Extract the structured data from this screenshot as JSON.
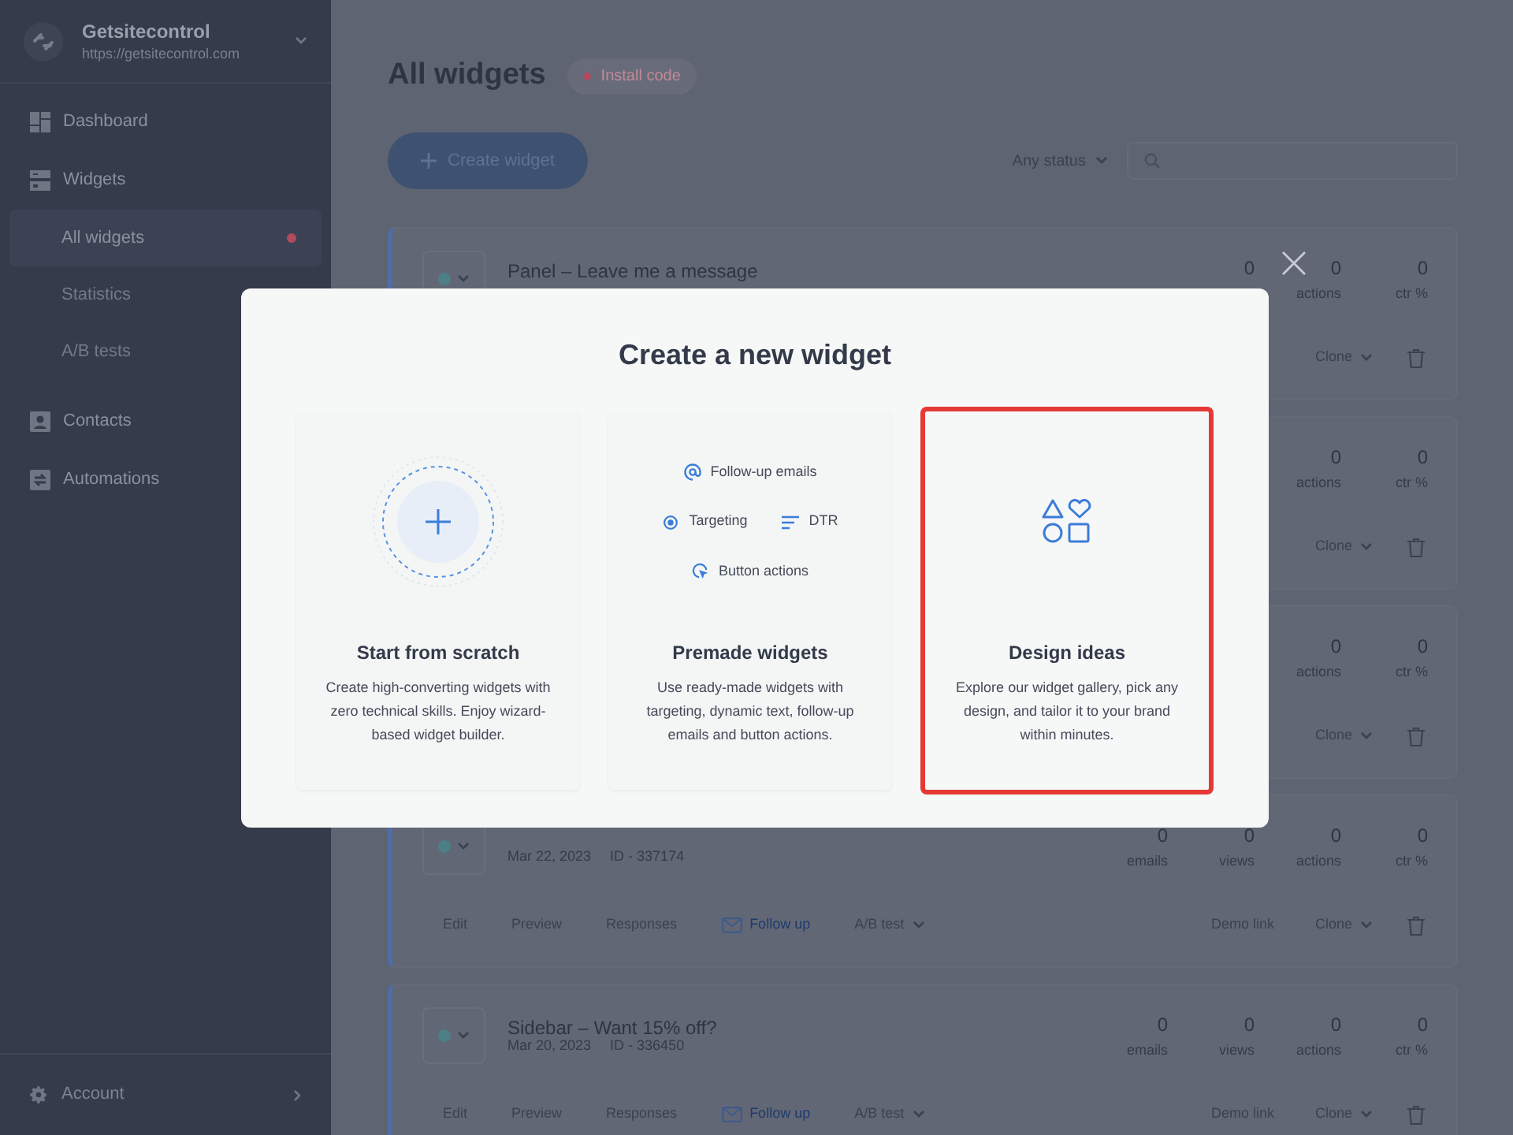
{
  "sidebar": {
    "brand": {
      "name": "Getsitecontrol",
      "url": "https://getsitecontrol.com"
    },
    "items": [
      {
        "kind": "section",
        "label": "Dashboard",
        "selected": false
      },
      {
        "kind": "section",
        "label": "Widgets",
        "selected": false
      },
      {
        "kind": "sub",
        "label": "All widgets",
        "selected": true,
        "alert": true
      },
      {
        "kind": "sub",
        "label": "Statistics",
        "selected": false
      },
      {
        "kind": "sub",
        "label": "A/B tests",
        "selected": false
      },
      {
        "kind": "section",
        "label": "Contacts",
        "selected": false
      },
      {
        "kind": "section",
        "label": "Automations",
        "selected": false
      }
    ],
    "account": "Account"
  },
  "header": {
    "title": "All widgets",
    "badge": "Install code",
    "create_button": "Create widget",
    "status_filter": "Any status"
  },
  "widgets": [
    {
      "title": "Panel – Leave me a message",
      "status_menu": true,
      "stats": [
        {
          "value": "0"
        },
        {
          "value": "0",
          "label": "actions"
        },
        {
          "value": "0",
          "label": "ctr %"
        }
      ],
      "right_actions": [
        "Clone"
      ]
    },
    {
      "stats": [
        {
          "value": "0",
          "label": "actions"
        },
        {
          "value": "0",
          "label": "ctr %"
        }
      ],
      "right_actions": [
        "Clone"
      ]
    },
    {
      "stats": [
        {
          "value": "0",
          "label": "actions"
        },
        {
          "value": "0",
          "label": "ctr %"
        }
      ],
      "right_actions": [
        "Clone"
      ]
    },
    {
      "status_menu": true,
      "date": "Mar 22, 2023",
      "id": "ID - 337174",
      "stats": [
        {
          "value": "0",
          "label": "emails"
        },
        {
          "value": "0",
          "label": "views"
        },
        {
          "value": "0",
          "label": "actions"
        },
        {
          "value": "0",
          "label": "ctr %"
        }
      ],
      "left_actions": [
        "Edit",
        "Preview",
        "Responses",
        "Follow up",
        "A/B test"
      ],
      "right_actions": [
        "Demo link",
        "Clone"
      ]
    },
    {
      "title": "Sidebar – Want 15% off?",
      "status_menu": true,
      "date": "Mar 20, 2023",
      "id": "ID - 336450",
      "stats": [
        {
          "value": "0",
          "label": "emails"
        },
        {
          "value": "0",
          "label": "views"
        },
        {
          "value": "0",
          "label": "actions"
        },
        {
          "value": "0",
          "label": "ctr %"
        }
      ],
      "left_actions": [
        "Edit",
        "Preview",
        "Responses",
        "Follow up",
        "A/B test"
      ],
      "right_actions": [
        "Demo link",
        "Clone"
      ]
    }
  ],
  "modal": {
    "title": "Create a new widget",
    "options": [
      {
        "kind": "scratch",
        "title": "Start from scratch",
        "description": "Create high-converting widgets with zero technical skills. Enjoy wizard-based widget builder.",
        "highlighted": false
      },
      {
        "kind": "premade",
        "title": "Premade widgets",
        "description": "Use ready-made widgets with targeting, dynamic text, follow-up emails and button actions.",
        "highlighted": false,
        "feature_rows": [
          [
            "Follow-up emails"
          ],
          [
            "Targeting",
            "DTR"
          ],
          [
            "Button actions"
          ]
        ]
      },
      {
        "kind": "gallery",
        "title": "Design ideas",
        "description": "Explore our widget gallery, pick any design, and tailor it to your brand within minutes.",
        "highlighted": true
      }
    ]
  }
}
